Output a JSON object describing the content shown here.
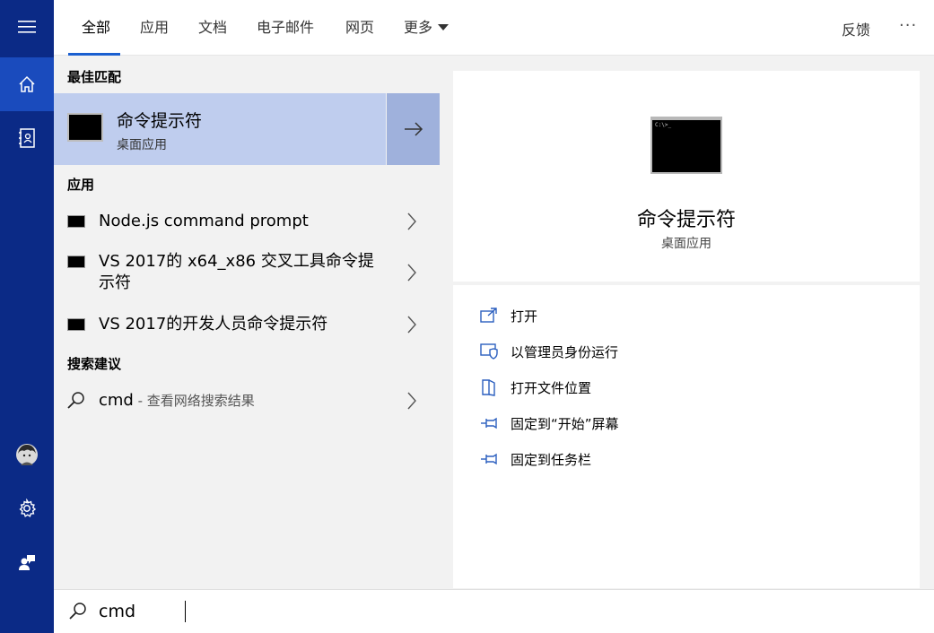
{
  "tabs": [
    {
      "label": "全部",
      "active": true
    },
    {
      "label": "应用"
    },
    {
      "label": "文档"
    },
    {
      "label": "电子邮件"
    },
    {
      "label": "网页"
    },
    {
      "label": "更多"
    }
  ],
  "header": {
    "feedback": "反馈",
    "more_options": "···"
  },
  "sections": {
    "best_match": "最佳匹配",
    "apps": "应用",
    "suggestions": "搜索建议"
  },
  "best_match": {
    "title": "命令提示符",
    "subtitle": "桌面应用"
  },
  "apps": [
    {
      "label": "Node.js command prompt"
    },
    {
      "label": "VS 2017的 x64_x86 交叉工具命令提示符"
    },
    {
      "label": "VS 2017的开发人员命令提示符"
    }
  ],
  "suggestion": {
    "query": "cmd",
    "hint": " - 查看网络搜索结果"
  },
  "preview": {
    "title": "命令提示符",
    "subtitle": "桌面应用",
    "icon": "cmd-window-icon"
  },
  "actions": [
    {
      "label": "打开",
      "icon": "open-icon"
    },
    {
      "label": "以管理员身份运行",
      "icon": "shield-icon"
    },
    {
      "label": "打开文件位置",
      "icon": "file-location-icon"
    },
    {
      "label": "固定到“开始”屏幕",
      "icon": "pin-icon"
    },
    {
      "label": "固定到任务栏",
      "icon": "pin-icon"
    }
  ],
  "search": {
    "value": "cmd"
  },
  "colors": {
    "rail": "#0b2a86",
    "rail_active": "#1a4bbd",
    "selection": "#bfcdee",
    "accent": "#1a5fd0"
  }
}
